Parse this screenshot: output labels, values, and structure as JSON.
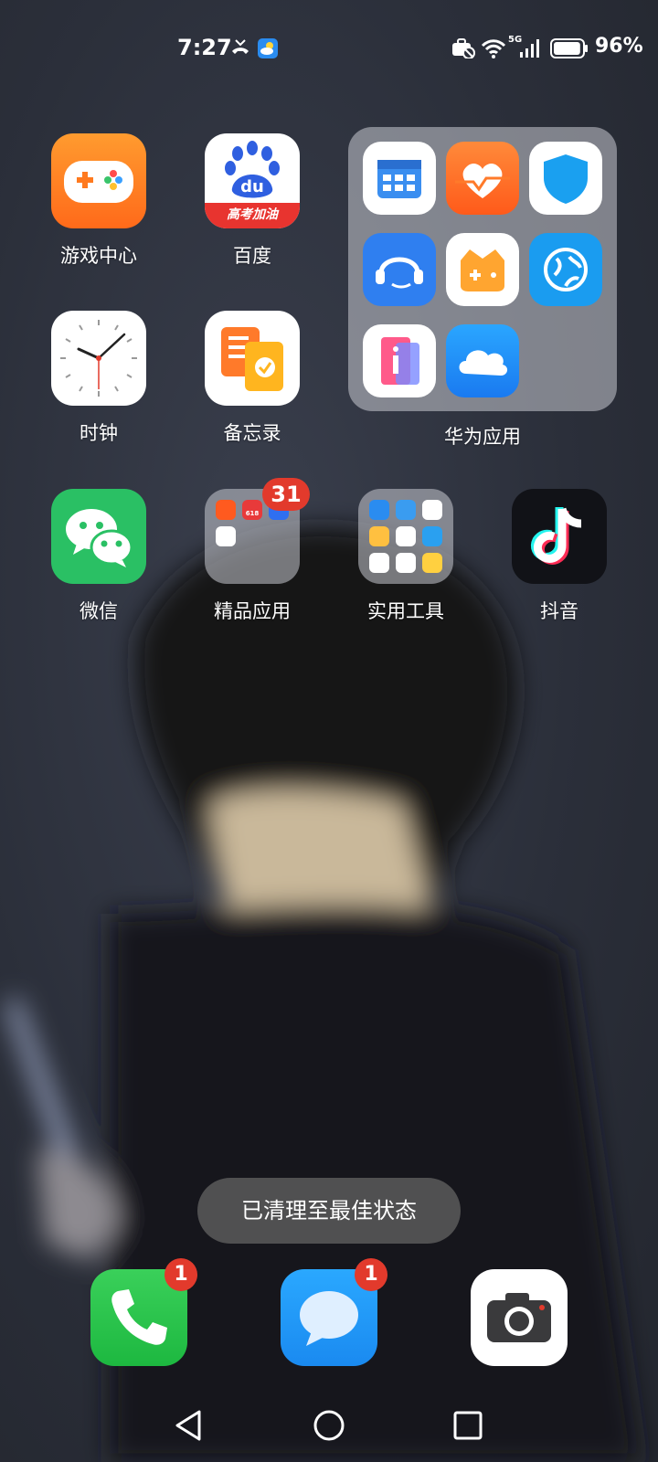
{
  "status_bar": {
    "time": "7:27",
    "network": "5G",
    "battery_percent": "96%",
    "battery_level": 0.96
  },
  "home": {
    "row1": [
      {
        "label": "游戏中心",
        "icon": "game-center-icon"
      },
      {
        "label": "百度",
        "icon": "baidu-icon",
        "banner": "高考加油"
      }
    ],
    "row2": [
      {
        "label": "时钟",
        "icon": "clock-icon"
      },
      {
        "label": "备忘录",
        "icon": "memo-icon"
      }
    ],
    "huawei_folder": {
      "label": "华为应用",
      "apps": [
        "calendar-icon",
        "health-icon",
        "security-shield-icon",
        "service-icon",
        "game-icon",
        "browser-globe-icon",
        "tips-icon",
        "cloud-icon"
      ]
    },
    "row3": [
      {
        "label": "微信",
        "icon": "wechat-icon"
      },
      {
        "label": "精品应用",
        "icon": "folder-icon",
        "badge": "31",
        "mini_text": "618"
      },
      {
        "label": "实用工具",
        "icon": "folder-icon"
      },
      {
        "label": "抖音",
        "icon": "douyin-icon"
      }
    ]
  },
  "toast": "已清理至最佳状态",
  "dock": [
    {
      "name": "phone",
      "badge": "1"
    },
    {
      "name": "messages",
      "badge": "1"
    },
    {
      "name": "camera"
    }
  ],
  "colors": {
    "badge": "#e23a2c",
    "wechat": "#2ac064",
    "phone": "#27c24c",
    "messages": "#1a9cf0"
  }
}
